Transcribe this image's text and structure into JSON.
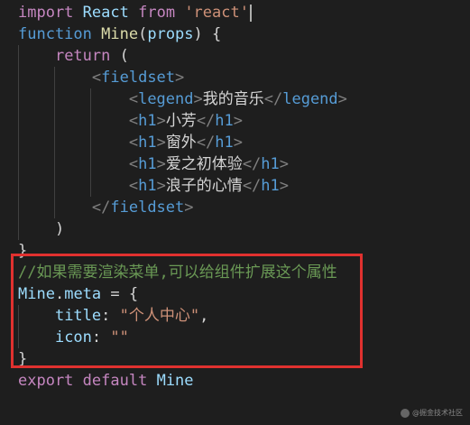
{
  "lines": [
    {
      "tokens": [
        {
          "t": "import",
          "c": "kw"
        },
        {
          "t": " ",
          "c": "txt"
        },
        {
          "t": "React",
          "c": "param"
        },
        {
          "t": " ",
          "c": "txt"
        },
        {
          "t": "from",
          "c": "kw"
        },
        {
          "t": " ",
          "c": "txt"
        },
        {
          "t": "'react'",
          "c": "str"
        }
      ],
      "cursor": true
    },
    {
      "tokens": [
        {
          "t": "function",
          "c": "kw2"
        },
        {
          "t": " ",
          "c": "txt"
        },
        {
          "t": "Mine",
          "c": "fn"
        },
        {
          "t": "(",
          "c": "punc"
        },
        {
          "t": "props",
          "c": "param"
        },
        {
          "t": ") {",
          "c": "punc"
        }
      ]
    },
    {
      "tokens": [
        {
          "t": "    ",
          "c": "txt"
        },
        {
          "t": "return",
          "c": "kw"
        },
        {
          "t": " (",
          "c": "punc"
        }
      ]
    },
    {
      "tokens": [
        {
          "t": "        ",
          "c": "txt"
        },
        {
          "t": "<",
          "c": "br"
        },
        {
          "t": "fieldset",
          "c": "tag"
        },
        {
          "t": ">",
          "c": "br"
        }
      ]
    },
    {
      "tokens": [
        {
          "t": "            ",
          "c": "txt"
        },
        {
          "t": "<",
          "c": "br"
        },
        {
          "t": "legend",
          "c": "tag"
        },
        {
          "t": ">",
          "c": "br"
        },
        {
          "t": "我的音乐",
          "c": "txt"
        },
        {
          "t": "</",
          "c": "br"
        },
        {
          "t": "legend",
          "c": "tag"
        },
        {
          "t": ">",
          "c": "br"
        }
      ]
    },
    {
      "tokens": [
        {
          "t": "            ",
          "c": "txt"
        },
        {
          "t": "<",
          "c": "br"
        },
        {
          "t": "h1",
          "c": "tag"
        },
        {
          "t": ">",
          "c": "br"
        },
        {
          "t": "小芳",
          "c": "txt"
        },
        {
          "t": "</",
          "c": "br"
        },
        {
          "t": "h1",
          "c": "tag"
        },
        {
          "t": ">",
          "c": "br"
        }
      ]
    },
    {
      "tokens": [
        {
          "t": "            ",
          "c": "txt"
        },
        {
          "t": "<",
          "c": "br"
        },
        {
          "t": "h1",
          "c": "tag"
        },
        {
          "t": ">",
          "c": "br"
        },
        {
          "t": "窗外",
          "c": "txt"
        },
        {
          "t": "</",
          "c": "br"
        },
        {
          "t": "h1",
          "c": "tag"
        },
        {
          "t": ">",
          "c": "br"
        }
      ]
    },
    {
      "tokens": [
        {
          "t": "            ",
          "c": "txt"
        },
        {
          "t": "<",
          "c": "br"
        },
        {
          "t": "h1",
          "c": "tag"
        },
        {
          "t": ">",
          "c": "br"
        },
        {
          "t": "爱之初体验",
          "c": "txt"
        },
        {
          "t": "</",
          "c": "br"
        },
        {
          "t": "h1",
          "c": "tag"
        },
        {
          "t": ">",
          "c": "br"
        }
      ]
    },
    {
      "tokens": [
        {
          "t": "            ",
          "c": "txt"
        },
        {
          "t": "<",
          "c": "br"
        },
        {
          "t": "h1",
          "c": "tag"
        },
        {
          "t": ">",
          "c": "br"
        },
        {
          "t": "浪子的心情",
          "c": "txt"
        },
        {
          "t": "</",
          "c": "br"
        },
        {
          "t": "h1",
          "c": "tag"
        },
        {
          "t": ">",
          "c": "br"
        }
      ]
    },
    {
      "tokens": [
        {
          "t": "        ",
          "c": "txt"
        },
        {
          "t": "</",
          "c": "br"
        },
        {
          "t": "fieldset",
          "c": "tag"
        },
        {
          "t": ">",
          "c": "br"
        }
      ]
    },
    {
      "tokens": [
        {
          "t": "    ",
          "c": "txt"
        },
        {
          "t": ")",
          "c": "punc"
        }
      ]
    },
    {
      "tokens": [
        {
          "t": "}",
          "c": "punc"
        }
      ]
    },
    {
      "tokens": [
        {
          "t": "//如果需要渲染菜单,可以给组件扩展这个属性",
          "c": "cmt"
        }
      ]
    },
    {
      "tokens": [
        {
          "t": "Mine",
          "c": "param"
        },
        {
          "t": ".",
          "c": "punc"
        },
        {
          "t": "meta",
          "c": "param"
        },
        {
          "t": " = {",
          "c": "punc"
        }
      ]
    },
    {
      "tokens": [
        {
          "t": "    ",
          "c": "txt"
        },
        {
          "t": "title",
          "c": "param"
        },
        {
          "t": ": ",
          "c": "punc"
        },
        {
          "t": "\"个人中心\"",
          "c": "str"
        },
        {
          "t": ",",
          "c": "punc"
        }
      ]
    },
    {
      "tokens": [
        {
          "t": "    ",
          "c": "txt"
        },
        {
          "t": "icon",
          "c": "param"
        },
        {
          "t": ": ",
          "c": "punc"
        },
        {
          "t": "\"\"",
          "c": "str"
        }
      ]
    },
    {
      "tokens": [
        {
          "t": "}",
          "c": "punc"
        }
      ]
    },
    {
      "tokens": [
        {
          "t": "export",
          "c": "kw"
        },
        {
          "t": " ",
          "c": "txt"
        },
        {
          "t": "default",
          "c": "kw"
        },
        {
          "t": " ",
          "c": "txt"
        },
        {
          "t": "Mine",
          "c": "param"
        }
      ]
    }
  ],
  "indent_guides": [
    {
      "line": 2,
      "levels": 1
    },
    {
      "line": 3,
      "levels": 2
    },
    {
      "line": 4,
      "levels": 3
    },
    {
      "line": 5,
      "levels": 3
    },
    {
      "line": 6,
      "levels": 3
    },
    {
      "line": 7,
      "levels": 3
    },
    {
      "line": 8,
      "levels": 3
    },
    {
      "line": 9,
      "levels": 2
    },
    {
      "line": 10,
      "levels": 1
    },
    {
      "line": 14,
      "levels": 1
    },
    {
      "line": 15,
      "levels": 1
    }
  ],
  "highlight": {
    "color": "#e0312f"
  },
  "watermark": {
    "text": "@掘金技术社区"
  }
}
